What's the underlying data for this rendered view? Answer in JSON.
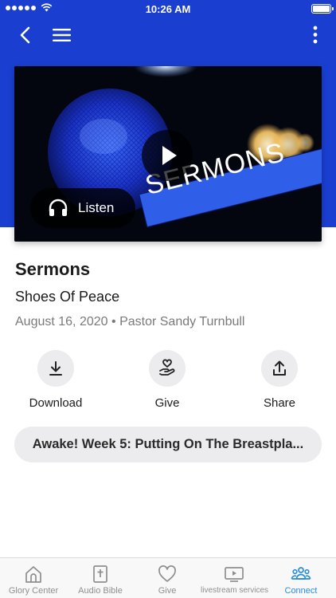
{
  "status_bar": {
    "time": "10:26 AM"
  },
  "nav": {
    "back_icon": "chevron-left-icon",
    "menu_icon": "hamburger-icon",
    "more_icon": "vertical-dots-icon"
  },
  "hero": {
    "banner_text": "SERMONS",
    "listen_label": "Listen"
  },
  "sermon": {
    "title": "Sermons",
    "subtitle": "Shoes Of Peace",
    "date": "August 16, 2020",
    "separator": "•",
    "speaker": "Pastor Sandy Turnbull"
  },
  "actions": {
    "download_label": "Download",
    "give_label": "Give",
    "share_label": "Share"
  },
  "series": {
    "label": "Awake! Week 5: Putting On The Breastpla..."
  },
  "tabs": [
    {
      "label": "Glory Center",
      "icon": "church-icon",
      "active": false
    },
    {
      "label": "Audio Bible",
      "icon": "bible-icon",
      "active": false
    },
    {
      "label": "Give",
      "icon": "heart-icon",
      "active": false
    },
    {
      "label": "livestream services",
      "icon": "video-play-icon",
      "active": false
    },
    {
      "label": "Connect",
      "icon": "people-icon",
      "active": true
    }
  ],
  "colors": {
    "header_blue": "#1a3fd0",
    "active_tab": "#2b8fd6",
    "inactive_tab": "#8e8e8e"
  }
}
